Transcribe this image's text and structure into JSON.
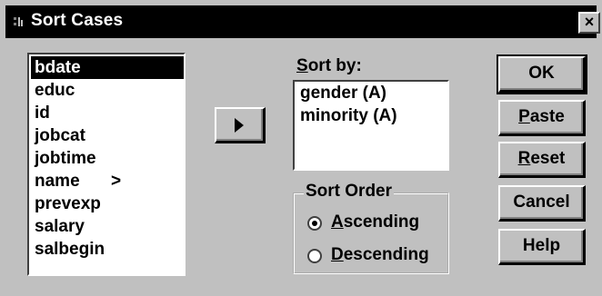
{
  "window": {
    "title": "Sort Cases",
    "close_label": "×"
  },
  "variable_list": {
    "items": [
      {
        "label": "bdate",
        "selected": true
      },
      {
        "label": "educ"
      },
      {
        "label": "id"
      },
      {
        "label": "jobcat"
      },
      {
        "label": "jobtime"
      },
      {
        "label": "name",
        "suffix": ">"
      },
      {
        "label": "prevexp"
      },
      {
        "label": "salary"
      },
      {
        "label": "salbegin"
      }
    ]
  },
  "sort_by": {
    "label_prefix": "",
    "label_mnemonic": "S",
    "label_rest": "ort by:",
    "items": [
      "gender (A)",
      "minority (A)"
    ]
  },
  "sort_order": {
    "title": "Sort Order",
    "ascending_mnemonic": "A",
    "ascending_rest": "scending",
    "descending_mnemonic": "D",
    "descending_rest": "escending",
    "selected": "ascending"
  },
  "buttons": {
    "ok": "OK",
    "paste_mnemonic": "P",
    "paste_rest": "aste",
    "reset_mnemonic": "R",
    "reset_rest": "eset",
    "cancel": "Cancel",
    "help": "Help"
  }
}
